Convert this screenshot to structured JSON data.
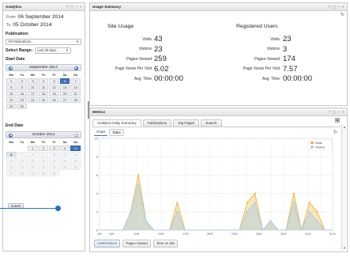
{
  "left": {
    "title": "Analytics",
    "controls": "? ▢ – ×",
    "from_label": "From",
    "from_value": "06 September 2014",
    "to_label": "To",
    "to_value": "05 October 2014",
    "publication_label": "Publication:",
    "publication_value": "All Publications",
    "range_label": "Select Range:",
    "range_value": "Last 30 days",
    "start_label": "Start Date",
    "end_label": "End Date",
    "submit_label": "Submit",
    "weekdays": [
      "Mo",
      "Tu",
      "We",
      "Th",
      "Fr",
      "Sa",
      "Su"
    ],
    "start_cal": {
      "title": "September 2014",
      "weeks": [
        [
          "1",
          "2",
          "3",
          "4",
          "5",
          "6",
          "7"
        ],
        [
          "8",
          "9",
          "10",
          "11",
          "12",
          "13",
          "14"
        ],
        [
          "15",
          "16",
          "17",
          "18",
          "19",
          "20",
          "21"
        ],
        [
          "22",
          "23",
          "24",
          "25",
          "26",
          "27",
          "28"
        ],
        [
          "29",
          "30",
          "",
          "",
          "",
          "",
          ""
        ]
      ],
      "selected": "6"
    },
    "end_cal": {
      "title": "October 2014",
      "weeks": [
        [
          "",
          "",
          "1",
          "2",
          "3",
          "4",
          "5"
        ],
        [
          "6",
          "7",
          "8",
          "9",
          "10",
          "11",
          "12"
        ],
        [
          "13",
          "14",
          "15",
          "16",
          "17",
          "18",
          "19"
        ],
        [
          "20",
          "21",
          "22",
          "23",
          "24",
          "25",
          "26"
        ],
        [
          "27",
          "28",
          "29",
          "30",
          "31",
          "",
          ""
        ]
      ],
      "selected": "5",
      "disabled_after": "6"
    }
  },
  "usage": {
    "title": "Usage Summary",
    "controls": "? ▢ – ×",
    "refresh_icon": "↻",
    "site": {
      "heading": "Site Usage",
      "rows": [
        {
          "label": "Visits",
          "value": "43"
        },
        {
          "label": "Visitors",
          "value": "23"
        },
        {
          "label": "Pages Viewed",
          "value": "259"
        },
        {
          "label": "Page Views Per Visit",
          "value": "6.02"
        },
        {
          "label": "Avg. Time",
          "value": "00:00:00"
        }
      ]
    },
    "registered": {
      "heading": "Registered Users",
      "rows": [
        {
          "label": "Visits",
          "value": "23"
        },
        {
          "label": "Visitors",
          "value": "3"
        },
        {
          "label": "Pages Viewed",
          "value": "174"
        },
        {
          "label": "Page Views Per Visit",
          "value": "7.57"
        },
        {
          "label": "Avg. Time",
          "value": "00:00:00"
        }
      ]
    }
  },
  "metrics": {
    "title": "Metrics",
    "controls": "? ▢ – ×",
    "tabs": [
      "Analytics Daily Summary",
      "Publications",
      "Top Pages",
      "Search"
    ],
    "active_tab": 0,
    "subtabs": [
      "Chart",
      "Table"
    ],
    "active_subtab": 0,
    "refresh_icon": "↻",
    "bottom_buttons": [
      "Visits/Visitors",
      "Pages Viewed",
      "Time on site"
    ],
    "active_bottom": 0
  },
  "colors": {
    "visits": "#f0b43c",
    "visitors": "#a9cbe6",
    "accent": "#3b6fb2"
  },
  "chart_data": {
    "type": "area",
    "x": [
      "5/9",
      "6/9",
      "7/9",
      "8/9",
      "9/9",
      "10/9",
      "11/9",
      "12/9",
      "13/9",
      "14/9",
      "15/9",
      "16/9",
      "17/9",
      "18/9",
      "19/9",
      "20/9",
      "21/9",
      "22/9",
      "23/9",
      "24/9",
      "25/9",
      "26/9",
      "27/9",
      "28/9",
      "29/9",
      "30/9",
      "1/10",
      "2/10",
      "3/10",
      "4/10",
      "5/10"
    ],
    "x_tick_labels": [
      "4/9",
      "6/9",
      "",
      "11/9",
      "",
      "14/9",
      "",
      "17/9",
      "",
      "20/9",
      "",
      "23/9",
      "",
      "26/9",
      "",
      "29/9",
      "",
      "2/10",
      "",
      "5/10"
    ],
    "series": [
      {
        "name": "Visits",
        "values": [
          0,
          0,
          0,
          0,
          2,
          6,
          1,
          0,
          0,
          0,
          3,
          0,
          0,
          0,
          0,
          0,
          0,
          0,
          0,
          3,
          4,
          0,
          1,
          0,
          0,
          4,
          0,
          3,
          2,
          0,
          0
        ]
      },
      {
        "name": "Visitors",
        "values": [
          0,
          0,
          0,
          0,
          2,
          5,
          1,
          0,
          0,
          0,
          2,
          0,
          0,
          0,
          0,
          0,
          0,
          0,
          0,
          2,
          3,
          0,
          1,
          0,
          0,
          3,
          0,
          2,
          1,
          0,
          0
        ]
      }
    ],
    "ylim": [
      0,
      10
    ],
    "y_ticks": [
      0,
      2,
      4,
      6,
      8,
      10
    ],
    "grid": true,
    "legend": "top-right"
  }
}
